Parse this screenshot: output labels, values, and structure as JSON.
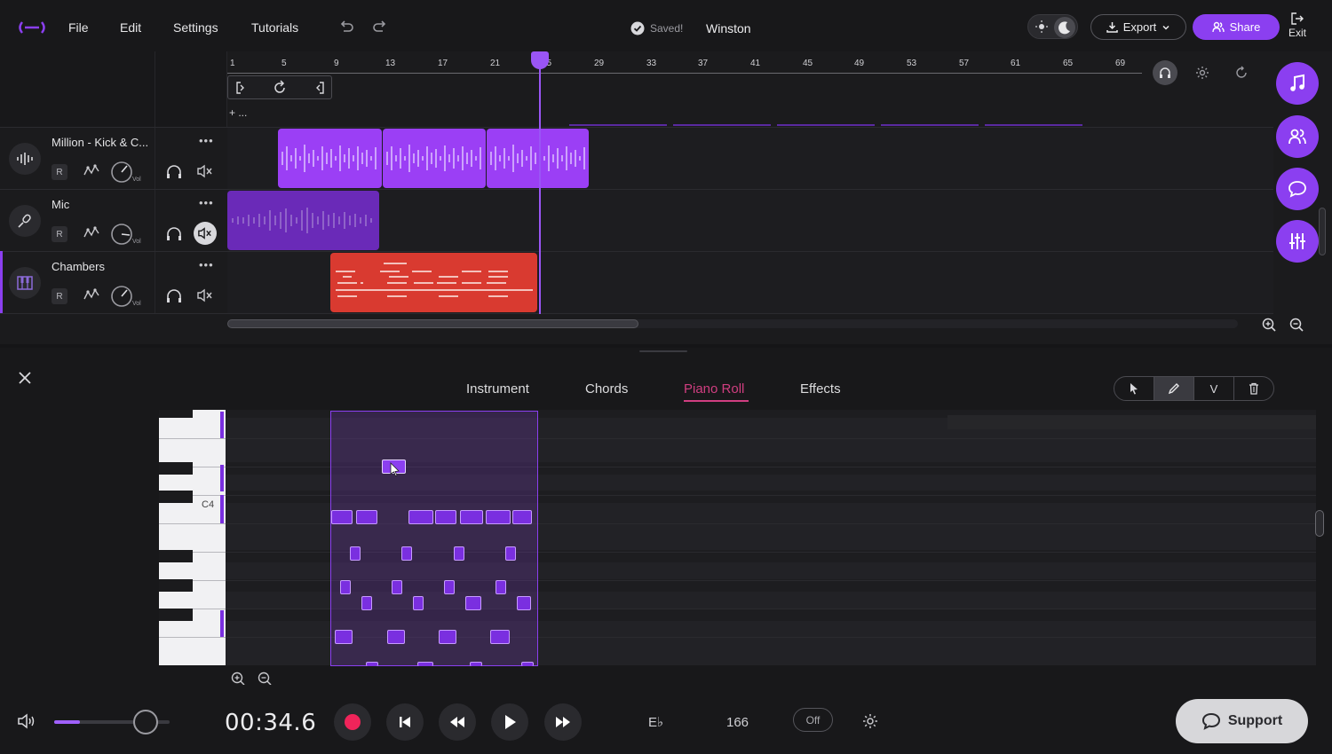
{
  "menu": {
    "file": "File",
    "edit": "Edit",
    "settings": "Settings",
    "tutorials": "Tutorials"
  },
  "status": {
    "saved": "Saved!",
    "project_name": "Winston"
  },
  "header": {
    "export_label": "Export",
    "share_label": "Share",
    "exit_label": "Exit"
  },
  "ruler": {
    "ticks": [
      "1",
      "5",
      "9",
      "13",
      "17",
      "21",
      "25",
      "29",
      "33",
      "37",
      "41",
      "45",
      "49",
      "53",
      "57",
      "61",
      "65",
      "69"
    ]
  },
  "loop": {
    "add_label": "+ ..."
  },
  "tracks": [
    {
      "name": "Million - Kick & C...",
      "more": "•••",
      "record": "R",
      "vol_label": "Vol",
      "icon": "waveform-icon"
    },
    {
      "name": "Mic",
      "more": "•••",
      "record": "R",
      "vol_label": "Vol",
      "icon": "microphone-icon"
    },
    {
      "name": "Chambers",
      "more": "•••",
      "record": "R",
      "vol_label": "Vol",
      "icon": "keyboard-icon"
    }
  ],
  "editor": {
    "tabs": [
      "Instrument",
      "Chords",
      "Piano Roll",
      "Effects"
    ],
    "active_tab": "Piano Roll",
    "key_label": "C4",
    "tools": [
      "select-tool",
      "pencil-tool",
      "velocity-tool",
      "delete-tool"
    ],
    "velocity_label": "V"
  },
  "transport": {
    "time": "00:34.6",
    "key": "E♭",
    "bpm": "166",
    "metronome": "Off",
    "volume_level": 0.22
  },
  "support_label": "Support",
  "colors": {
    "accent": "#8b3ff0",
    "tab_active": "#d03e80",
    "mic_clip": "#6a2ab8",
    "chambers_clip": "#d93a30"
  }
}
